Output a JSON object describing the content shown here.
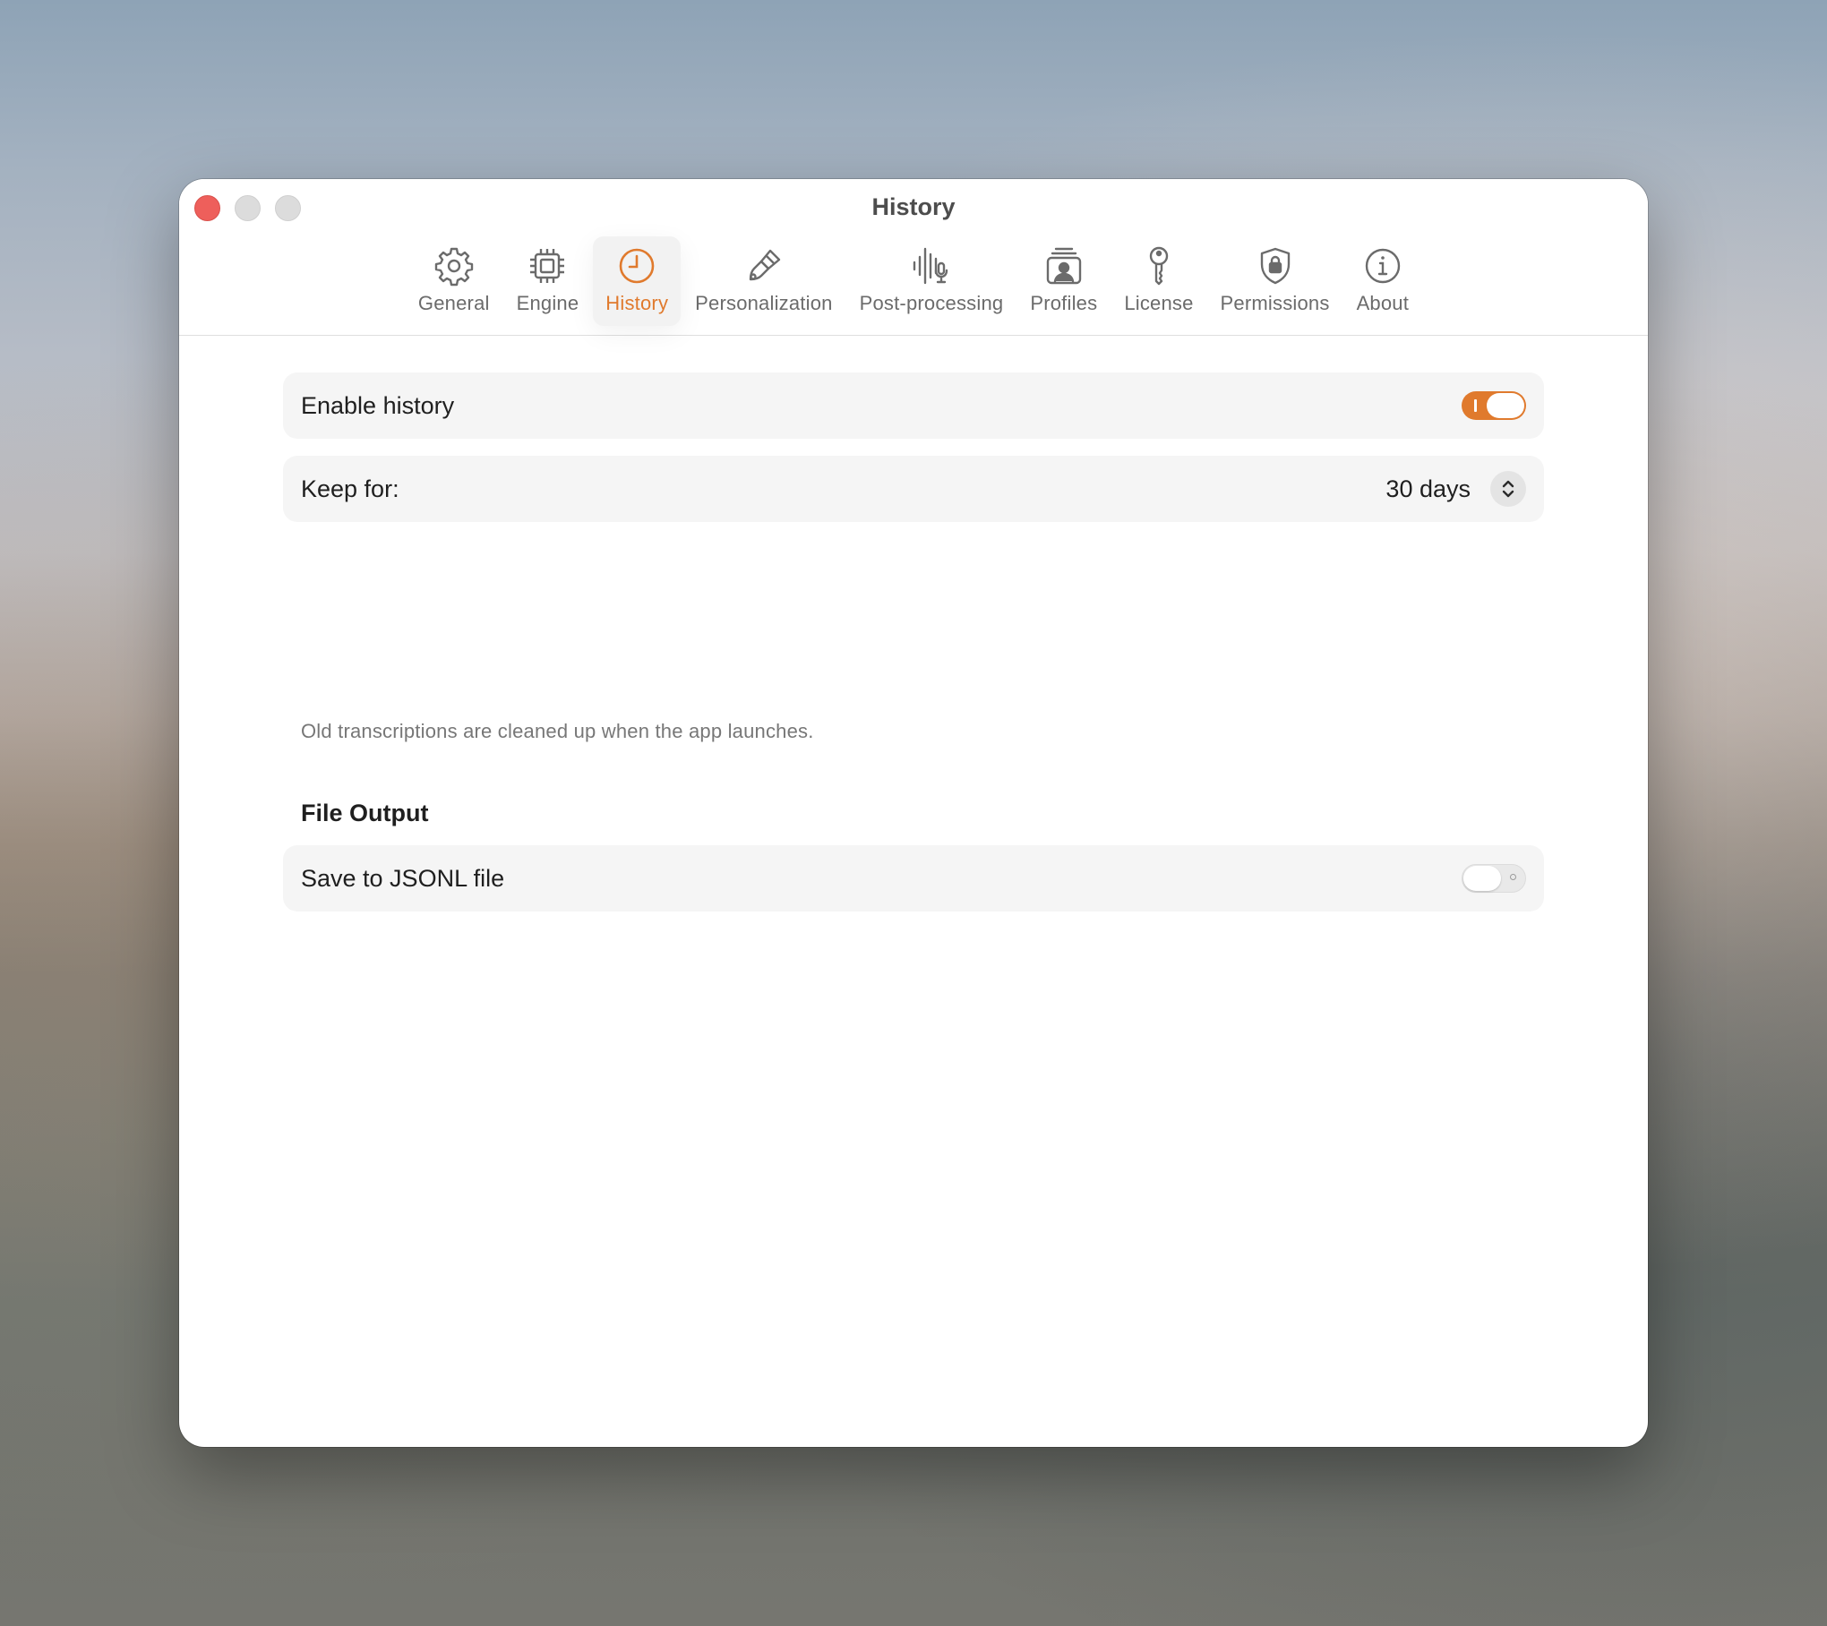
{
  "window": {
    "title": "History"
  },
  "tabs": [
    {
      "label": "General",
      "icon": "gear-icon",
      "active": false
    },
    {
      "label": "Engine",
      "icon": "chip-icon",
      "active": false
    },
    {
      "label": "History",
      "icon": "clock-icon",
      "active": true
    },
    {
      "label": "Personalization",
      "icon": "paintbrush-icon",
      "active": false
    },
    {
      "label": "Post-processing",
      "icon": "waveform-mic-icon",
      "active": false
    },
    {
      "label": "Profiles",
      "icon": "person-stack-icon",
      "active": false
    },
    {
      "label": "License",
      "icon": "key-icon",
      "active": false
    },
    {
      "label": "Permissions",
      "icon": "lock-shield-icon",
      "active": false
    },
    {
      "label": "About",
      "icon": "info-icon",
      "active": false
    }
  ],
  "settings": {
    "enable_history": {
      "label": "Enable history",
      "enabled": true
    },
    "keep_for": {
      "label": "Keep for:",
      "value": "30 days"
    },
    "hint": "Old transcriptions are cleaned up when the app launches."
  },
  "file_output": {
    "title": "File Output",
    "save_jsonl": {
      "label": "Save to JSONL file",
      "enabled": false
    }
  },
  "colors": {
    "accent": "#e07a2d",
    "close": "#ee5f5b"
  }
}
